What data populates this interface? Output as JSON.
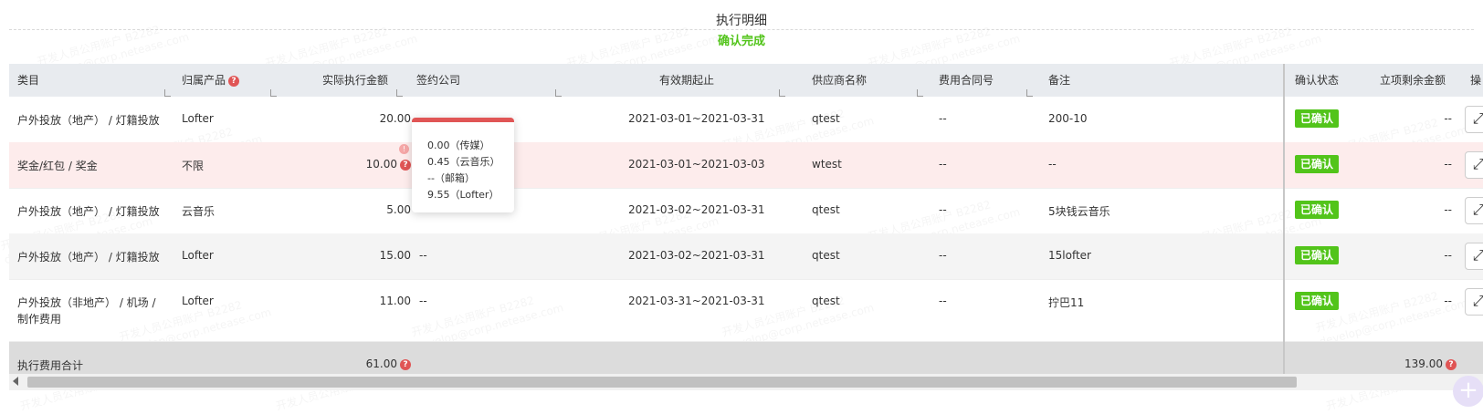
{
  "page": {
    "title": "执行明细",
    "status": "确认完成"
  },
  "columns": {
    "category": "类目",
    "product": "归属产品",
    "amount": "实际执行金额",
    "company": "签约公司",
    "period": "有效期起止",
    "supplier": "供应商名称",
    "contract": "费用合同号",
    "remark": "备注",
    "confirm": "确认状态",
    "remaining": "立项剩余金额",
    "ops": "操"
  },
  "rows": [
    {
      "category_line1": "户外投放（地产） / 灯籍投放",
      "category_line2": "",
      "product": "Lofter",
      "amount": "20.00",
      "company": "",
      "period": "2021-03-01~2021-03-31",
      "supplier": "qtest",
      "contract": "--",
      "remark": "200-10",
      "status": "已确认",
      "remaining": "--"
    },
    {
      "category_line1": "奖金/红包 / 奖金",
      "category_line2": "",
      "product": "不限",
      "amount": "10.00",
      "company": "",
      "period": "2021-03-01~2021-03-03",
      "supplier": "wtest",
      "contract": "--",
      "remark": "--",
      "status": "已确认",
      "remaining": "--"
    },
    {
      "category_line1": "户外投放（地产） / 灯籍投放",
      "category_line2": "",
      "product": "云音乐",
      "amount": "5.00",
      "company": "",
      "period": "2021-03-02~2021-03-31",
      "supplier": "qtest",
      "contract": "--",
      "remark": "5块钱云音乐",
      "status": "已确认",
      "remaining": "--"
    },
    {
      "category_line1": "户外投放（地产） / 灯籍投放",
      "category_line2": "",
      "product": "Lofter",
      "amount": "15.00",
      "company": "--",
      "period": "2021-03-02~2021-03-31",
      "supplier": "qtest",
      "contract": "--",
      "remark": "15lofter",
      "status": "已确认",
      "remaining": "--"
    },
    {
      "category_line1": "户外投放（非地产） / 机场 /",
      "category_line2": "制作费用",
      "product": "Lofter",
      "amount": "11.00",
      "company": "--",
      "period": "2021-03-31~2021-03-31",
      "supplier": "qtest",
      "contract": "--",
      "remark": "拧巴11",
      "status": "已确认",
      "remaining": "--"
    }
  ],
  "total": {
    "label": "执行费用合计",
    "amount": "61.00",
    "remaining": "139.00"
  },
  "popover": {
    "lines": [
      "0.00（传媒）",
      "0.45（云音乐）",
      "--（邮箱）",
      "9.55（Lofter）"
    ]
  },
  "icons": {
    "help": "help-circle-icon",
    "expand": "expand-icon",
    "warning": "warning-icon",
    "add": "plus-icon"
  },
  "colors": {
    "accent_green": "#52c41a",
    "danger_red": "#e05555",
    "header_bg": "#e8ebef",
    "highlight_row": "#fdecec"
  },
  "symbols": {
    "q": "?",
    "excl": "!",
    "expand": "⤢",
    "plus": "+"
  },
  "watermark": {
    "line1": "开发人员公用账户 B2282",
    "line2": "develop@corp.netease.com"
  }
}
